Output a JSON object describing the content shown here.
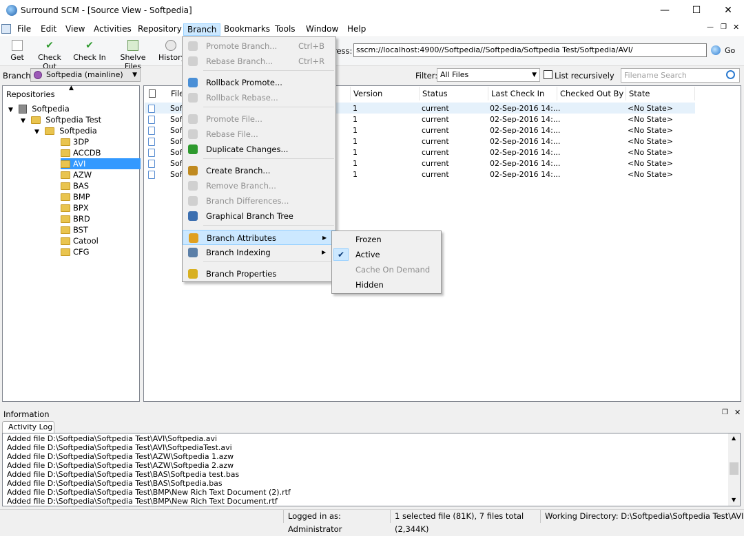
{
  "window": {
    "title": "Surround SCM - [Source View - Softpedia]"
  },
  "menu": [
    "File",
    "Edit",
    "View",
    "Activities",
    "Repository",
    "Branch",
    "Bookmarks",
    "Tools",
    "Window",
    "Help"
  ],
  "toolbar": {
    "buttons": [
      "Get",
      "Check Out",
      "Check In",
      "Shelve Files",
      "History"
    ],
    "address_label": "ress:",
    "address_value": "sscm://localhost:4900//Softpedia//Softpedia/Softpedia Test/Softpedia/AVI/",
    "go_label": "Go"
  },
  "branchbar": {
    "label": "Branch:",
    "value": "Softpedia (mainline)",
    "filter_label": "Filter:",
    "filter_value": "All Files",
    "recursive_label": "List recursively",
    "search_placeholder": "Filename Search"
  },
  "repositories": {
    "header": "Repositories",
    "root": "Softpedia",
    "child": "Softpedia Test",
    "grandchild": "Softpedia",
    "folders": [
      "3DP",
      "ACCDB",
      "AVI",
      "AZW",
      "BAS",
      "BMP",
      "BPX",
      "BRD",
      "BST",
      "Catool",
      "CFG"
    ],
    "selected": "AVI"
  },
  "files": {
    "columns": [
      "File",
      "Version",
      "Status",
      "Last Check In",
      "Checked Out By",
      "State"
    ],
    "rows": [
      {
        "name": "Sof",
        "version": "1",
        "status": "current",
        "last": "02-Sep-2016 14:...",
        "by": "",
        "state": "<No State>"
      },
      {
        "name": "Sof",
        "version": "1",
        "status": "current",
        "last": "02-Sep-2016 14:...",
        "by": "",
        "state": "<No State>"
      },
      {
        "name": "Sof",
        "version": "1",
        "status": "current",
        "last": "02-Sep-2016 14:...",
        "by": "",
        "state": "<No State>"
      },
      {
        "name": "Sof",
        "version": "1",
        "status": "current",
        "last": "02-Sep-2016 14:...",
        "by": "",
        "state": "<No State>"
      },
      {
        "name": "Sof",
        "version": "1",
        "status": "current",
        "last": "02-Sep-2016 14:...",
        "by": "",
        "state": "<No State>"
      },
      {
        "name": "Sof",
        "version": "1",
        "status": "current",
        "last": "02-Sep-2016 14:...",
        "by": "",
        "state": "<No State>"
      },
      {
        "name": "Sof",
        "version": "1",
        "status": "current",
        "last": "02-Sep-2016 14:...",
        "by": "",
        "state": "<No State>"
      }
    ]
  },
  "branch_menu": {
    "items": [
      {
        "label": "Promote Branch...",
        "shortcut": "Ctrl+B",
        "disabled": true
      },
      {
        "label": "Rebase Branch...",
        "shortcut": "Ctrl+R",
        "disabled": true
      },
      {
        "label": "Rollback Promote...",
        "shortcut": "",
        "disabled": false
      },
      {
        "label": "Rollback Rebase...",
        "shortcut": "",
        "disabled": true
      },
      {
        "label": "Promote File...",
        "shortcut": "",
        "disabled": true
      },
      {
        "label": "Rebase File...",
        "shortcut": "",
        "disabled": true
      },
      {
        "label": "Duplicate Changes...",
        "shortcut": "",
        "disabled": false
      },
      {
        "label": "Create Branch...",
        "shortcut": "",
        "disabled": false
      },
      {
        "label": "Remove Branch...",
        "shortcut": "",
        "disabled": true
      },
      {
        "label": "Branch Differences...",
        "shortcut": "",
        "disabled": true
      },
      {
        "label": "Graphical Branch Tree",
        "shortcut": "",
        "disabled": false
      },
      {
        "label": "Branch Attributes",
        "shortcut": "",
        "disabled": false
      },
      {
        "label": "Branch Indexing",
        "shortcut": "",
        "disabled": false
      },
      {
        "label": "Branch Properties",
        "shortcut": "",
        "disabled": false
      }
    ]
  },
  "attributes_submenu": {
    "items": [
      {
        "label": "Frozen",
        "disabled": false,
        "checked": false
      },
      {
        "label": "Active",
        "disabled": false,
        "checked": true
      },
      {
        "label": "Cache On Demand",
        "disabled": true,
        "checked": false
      },
      {
        "label": "Hidden",
        "disabled": false,
        "checked": false
      }
    ]
  },
  "information": {
    "title": "Information",
    "tab": "Activity Log",
    "lines": [
      "Added file D:\\Softpedia\\Softpedia Test\\AVI\\Softpedia.avi",
      "Added file D:\\Softpedia\\Softpedia Test\\AVI\\SoftpediaTest.avi",
      "Added file D:\\Softpedia\\Softpedia Test\\AZW\\Softpedia 1.azw",
      "Added file D:\\Softpedia\\Softpedia Test\\AZW\\Softpedia 2.azw",
      "Added file D:\\Softpedia\\Softpedia Test\\BAS\\Softpedia test.bas",
      "Added file D:\\Softpedia\\Softpedia Test\\BAS\\Softpedia.bas",
      "Added file D:\\Softpedia\\Softpedia Test\\BMP\\New Rich Text Document (2).rtf",
      "Added file D:\\Softpedia\\Softpedia Test\\BMP\\New Rich Text Document.rtf"
    ]
  },
  "status": {
    "logged": "Logged in as: Administrator",
    "files": "1 selected file (81K), 7 files total (2,344K)",
    "workdir": "Working Directory: D:\\Softpedia\\Softpedia Test\\AVI"
  },
  "colors": {
    "selection": "#3399ff",
    "menu_highlight": "#cce8ff",
    "folder": "#e9c44f"
  }
}
